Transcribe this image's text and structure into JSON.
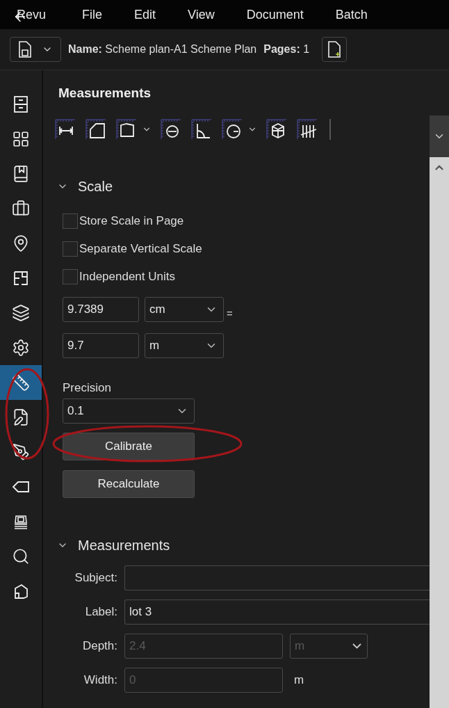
{
  "menu": [
    {
      "label": "Revu"
    },
    {
      "label": "File"
    },
    {
      "label": "Edit"
    },
    {
      "label": "View"
    },
    {
      "label": "Document"
    },
    {
      "label": "Batch"
    }
  ],
  "document_bar": {
    "name_label": "Name:",
    "name": "Scheme plan-A1 Scheme Plan",
    "pages_label": "Pages:",
    "pages": "1"
  },
  "rail": [
    {
      "kind": "cabinet",
      "selected": false
    },
    {
      "kind": "grid",
      "selected": false
    },
    {
      "kind": "book",
      "selected": false
    },
    {
      "kind": "toolbox",
      "selected": false
    },
    {
      "kind": "pin",
      "selected": false
    },
    {
      "kind": "plan",
      "selected": false
    },
    {
      "kind": "layers",
      "selected": false
    },
    {
      "kind": "gear",
      "selected": false
    },
    {
      "kind": "ruler",
      "selected": true
    },
    {
      "kind": "edit",
      "selected": false
    },
    {
      "kind": "pen",
      "selected": false
    },
    {
      "kind": "tag",
      "selected": false
    },
    {
      "kind": "stamp",
      "selected": false
    },
    {
      "kind": "search",
      "selected": false
    },
    {
      "kind": "house",
      "selected": false
    }
  ],
  "panel": {
    "title": "Measurements",
    "tools": [
      {
        "kind": "length",
        "dropdown": false
      },
      {
        "kind": "area",
        "dropdown": false
      },
      {
        "kind": "polyline",
        "dropdown": true
      },
      {
        "kind": "diameter",
        "dropdown": false
      },
      {
        "kind": "angle",
        "dropdown": false
      },
      {
        "kind": "radius",
        "dropdown": true
      },
      {
        "kind": "volume",
        "dropdown": false
      },
      {
        "kind": "count",
        "dropdown": false
      }
    ],
    "scale": {
      "title": "Scale",
      "expanded": true,
      "checkboxes": [
        {
          "label": "Store Scale in Page",
          "checked": false
        },
        {
          "label": "Separate Vertical Scale",
          "checked": false
        },
        {
          "label": "Independent Units",
          "checked": false
        }
      ],
      "rows": [
        {
          "value": "9.7389",
          "unit": "cm",
          "equals": "="
        },
        {
          "value": "9.7",
          "unit": "m"
        }
      ],
      "precision_label": "Precision",
      "precision": "0.1",
      "buttons": [
        "Calibrate",
        "Recalculate"
      ]
    },
    "measurements": {
      "title": "Measurements",
      "expanded": true,
      "fields": [
        {
          "kind": "text",
          "label": "Subject:",
          "disabled": false
        },
        {
          "kind": "text",
          "label": "Label:",
          "value": "lot 3",
          "disabled": false
        },
        {
          "kind": "unit_select",
          "label": "Depth:",
          "value": "2.4",
          "unit": "m",
          "disabled": true
        },
        {
          "kind": "unit_text",
          "label": "Width:",
          "value": "0",
          "unit": "m",
          "disabled": true
        }
      ]
    }
  }
}
